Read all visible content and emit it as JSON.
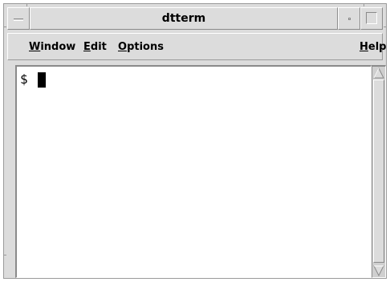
{
  "window": {
    "title": "dtterm"
  },
  "menubar": {
    "items": [
      {
        "mnemonic": "W",
        "rest": "indow"
      },
      {
        "mnemonic": "E",
        "rest": "dit"
      },
      {
        "mnemonic": "O",
        "rest": "ptions"
      },
      {
        "mnemonic": "H",
        "rest": "elp"
      }
    ]
  },
  "terminal": {
    "prompt": "$"
  },
  "icons": {
    "window_menu": "window-menu-icon",
    "minimize": "minimize-icon",
    "maximize": "maximize-icon",
    "scroll_up": "arrow-up-icon",
    "scroll_down": "arrow-down-icon"
  },
  "colors": {
    "chrome": "#dcdcdc",
    "terminal_bg": "#ffffff",
    "text": "#000000",
    "cursor": "#000000"
  }
}
